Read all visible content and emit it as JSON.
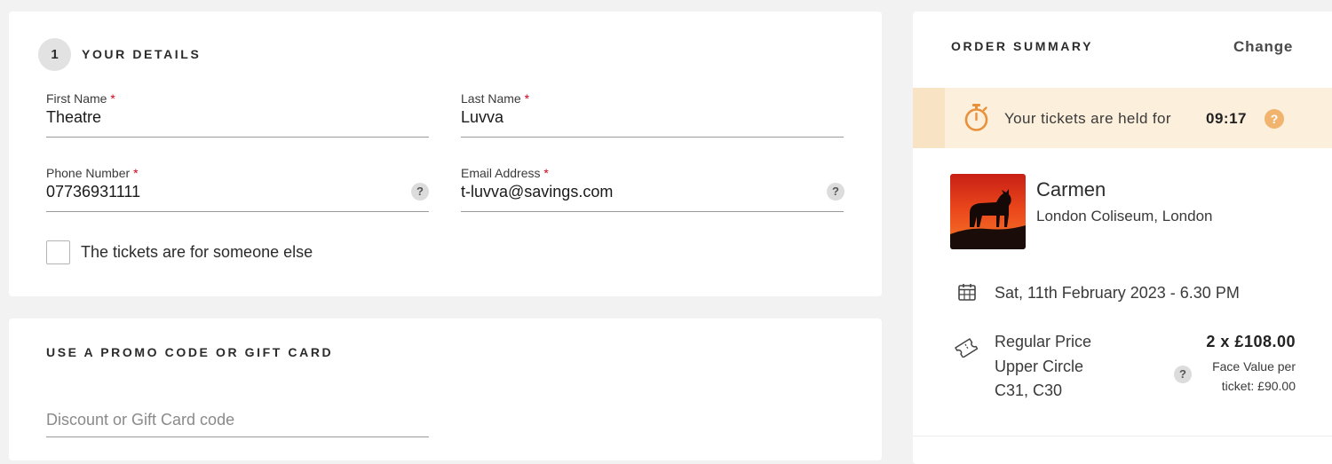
{
  "details": {
    "step_number": "1",
    "title": "YOUR DETAILS",
    "first_name": {
      "label": "First Name",
      "required_mark": "*",
      "value": "Theatre"
    },
    "last_name": {
      "label": "Last Name",
      "required_mark": "*",
      "value": "Luvva"
    },
    "phone": {
      "label": "Phone Number",
      "required_mark": "*",
      "value": "07736931111",
      "help": "?"
    },
    "email": {
      "label": "Email Address",
      "required_mark": "*",
      "value": "t-luvva@savings.com",
      "help": "?"
    },
    "someone_else_label": "The tickets are for someone else",
    "someone_else_checked": false
  },
  "promo": {
    "title": "USE A PROMO CODE OR GIFT CARD",
    "placeholder": "Discount or Gift Card code"
  },
  "summary": {
    "title": "ORDER SUMMARY",
    "change_label": "Change",
    "hold": {
      "text": "Your tickets are held for",
      "time": "09:17",
      "help": "?"
    },
    "show": {
      "title": "Carmen",
      "venue": "London Coliseum, London",
      "image_icon": "bull-silhouette-sunset-image"
    },
    "date": "Sat, 11th February 2023 - 6.30 PM",
    "ticket": {
      "price_type": "Regular Price",
      "section": "Upper Circle",
      "seats": "C31, C30",
      "quantity_price": "2 x £108.00",
      "face_value_line1": "Face Value per",
      "face_value_line2": "ticket: £90.00",
      "help": "?"
    }
  },
  "colors": {
    "background": "#f2f2f2",
    "card": "#ffffff",
    "hold_banner": "#fcefdb",
    "timer_accent": "#e8913a",
    "required": "#d0021b"
  }
}
